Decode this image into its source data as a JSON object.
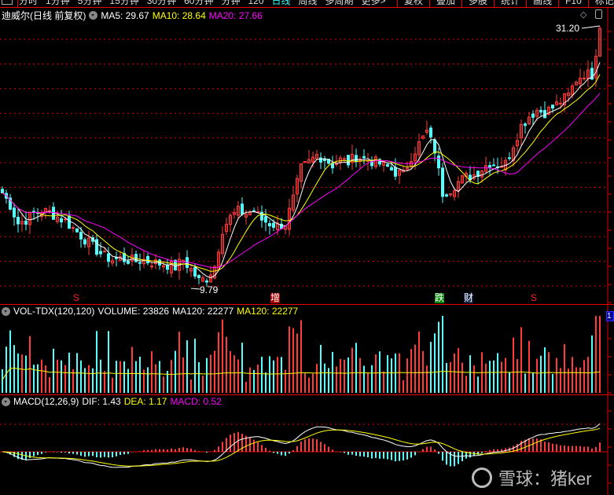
{
  "toolbar": {
    "tabs": [
      "分时",
      "1分钟",
      "5分钟",
      "15分钟",
      "30分钟",
      "60分钟",
      "分钟",
      "120",
      "日线",
      "周线",
      "多周期",
      "更多>"
    ],
    "active_tab": "日线",
    "buttons": [
      "复权",
      "叠加",
      "多股",
      "统计",
      "画线",
      "F10",
      "标记",
      "自选"
    ]
  },
  "price_panel": {
    "title": "迪威尔(日线 前复权)",
    "ma5": "MA5: 29.67",
    "ma10": "MA10: 28.64",
    "ma20": "MA20: 27.66",
    "high_label": "31.20",
    "low_label": "9.79",
    "markers": [
      {
        "text": "S",
        "color": "#f22",
        "bg": "transparent"
      },
      {
        "text": "增",
        "color": "#fff",
        "bg": "#a00"
      },
      {
        "text": "跌",
        "color": "#fff",
        "bg": "#080"
      },
      {
        "text": "财",
        "color": "#fff",
        "bg": "#124"
      },
      {
        "text": "S",
        "color": "#f22",
        "bg": "transparent"
      }
    ]
  },
  "volume_panel": {
    "title": "VOL-TDX(120,120)",
    "volume": "VOLUME: 23826",
    "ma1": "MA120: 22277",
    "ma2": "MA120: 22277"
  },
  "macd_panel": {
    "title": "MACD(12,26,9)",
    "dif": "DIF: 1.43",
    "dea": "DEA: 1.17",
    "macd": "MACD: 0.52"
  },
  "watermark": "雪球：猪ker",
  "colors": {
    "up": "#ff3b3b",
    "down": "#54ffff",
    "ma5": "#ffffff",
    "ma10": "#ffff00",
    "ma20": "#ff00ff",
    "grid": "#e00000"
  },
  "chart_data": {
    "type": "candlestick",
    "price_range": [
      9.79,
      31.2
    ],
    "closes": [
      17.5,
      16.5,
      15.0,
      15.3,
      15.8,
      16.0,
      15.9,
      15.5,
      15.2,
      14.6,
      14.0,
      13.4,
      12.8,
      12.3,
      12.0,
      12.1,
      12.0,
      11.9,
      12.0,
      11.8,
      11.7,
      11.6,
      11.4,
      12.0,
      11.2,
      10.3,
      10.5,
      11.5,
      14.5,
      15.5,
      16.0,
      15.8,
      16.0,
      15.3,
      15.0,
      14.8,
      15.0,
      17.0,
      19.5,
      20.0,
      20.6,
      20.3,
      19.8,
      20.2,
      20.0,
      20.5,
      20.3,
      20.1,
      19.9,
      19.6,
      19.2,
      19.0,
      20.5,
      21.5,
      22.5,
      21.0,
      17.5,
      17.8,
      18.4,
      18.8,
      19.0,
      19.5,
      20.0,
      19.8,
      19.9,
      21.5,
      23.0,
      23.8,
      24.3,
      24.1,
      24.5,
      25.0,
      25.5,
      26.8,
      27.3,
      27.2,
      31.0
    ]
  }
}
